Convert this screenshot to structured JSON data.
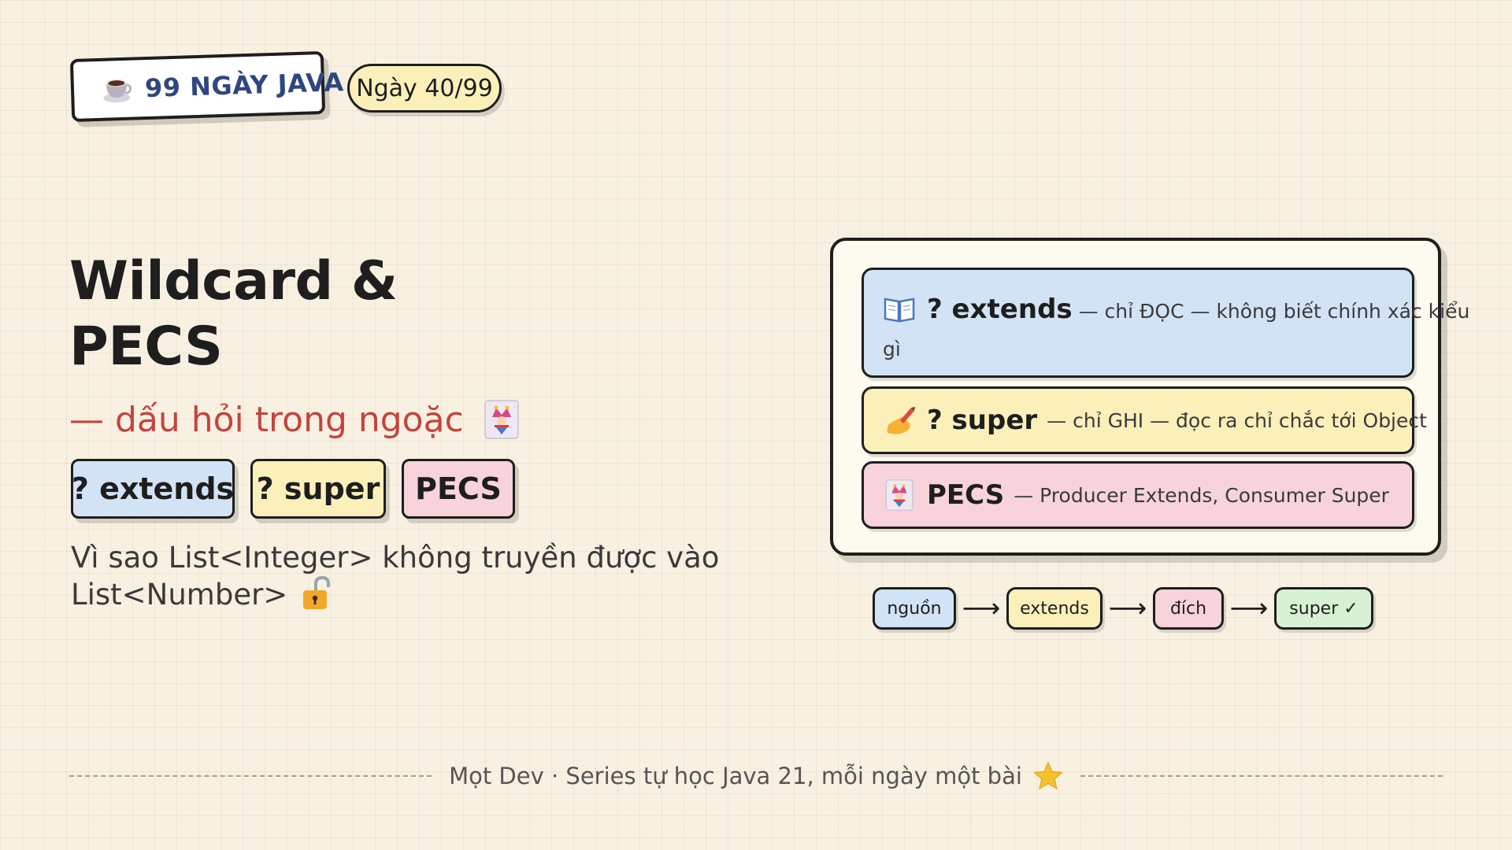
{
  "header": {
    "brand_label": "99 NGÀY JAVA",
    "day_label": "Ngày 40/99"
  },
  "title": {
    "line1": "Wildcard &",
    "line2": "PECS",
    "subtitle": "— dấu hỏi trong ngoặc"
  },
  "tags": [
    {
      "label": "? extends",
      "color": "#d3e3f6"
    },
    {
      "label": "? super",
      "color": "#fcf0ba"
    },
    {
      "label": "PECS",
      "color": "#f8d3dc"
    }
  ],
  "question": {
    "line1": "Vì sao List<Integer> không truyền được vào",
    "line2": "List<Number>"
  },
  "card": {
    "rows": [
      {
        "icon": "book-icon",
        "head": "? extends",
        "desc": "— chỉ ĐỌC — không biết chính xác kiểu",
        "desc_cont": "gì",
        "color": "#d3e3f6"
      },
      {
        "icon": "writing-hand-icon",
        "head": "? super",
        "desc": "— chỉ GHI — đọc ra chỉ chắc tới Object",
        "color": "#fcf0ba"
      },
      {
        "icon": "jester-icon",
        "head": "PECS",
        "desc": "— Producer Extends, Consumer Super",
        "color": "#f8d3dc"
      }
    ]
  },
  "flow": {
    "steps": [
      "nguồn",
      "extends",
      "đích",
      "super ✓"
    ],
    "arrow": "⟶"
  },
  "footer": {
    "text": "Mọt Dev · Series tự học Java 21, mỗi ngày một bài"
  },
  "colors": {
    "background": "#f8f1e2",
    "accent_red": "#c4443e",
    "brand_blue": "#2f4680",
    "blue": "#d3e3f6",
    "yellow": "#fcf0ba",
    "pink": "#f8d3dc",
    "green": "#d8f0d4"
  }
}
